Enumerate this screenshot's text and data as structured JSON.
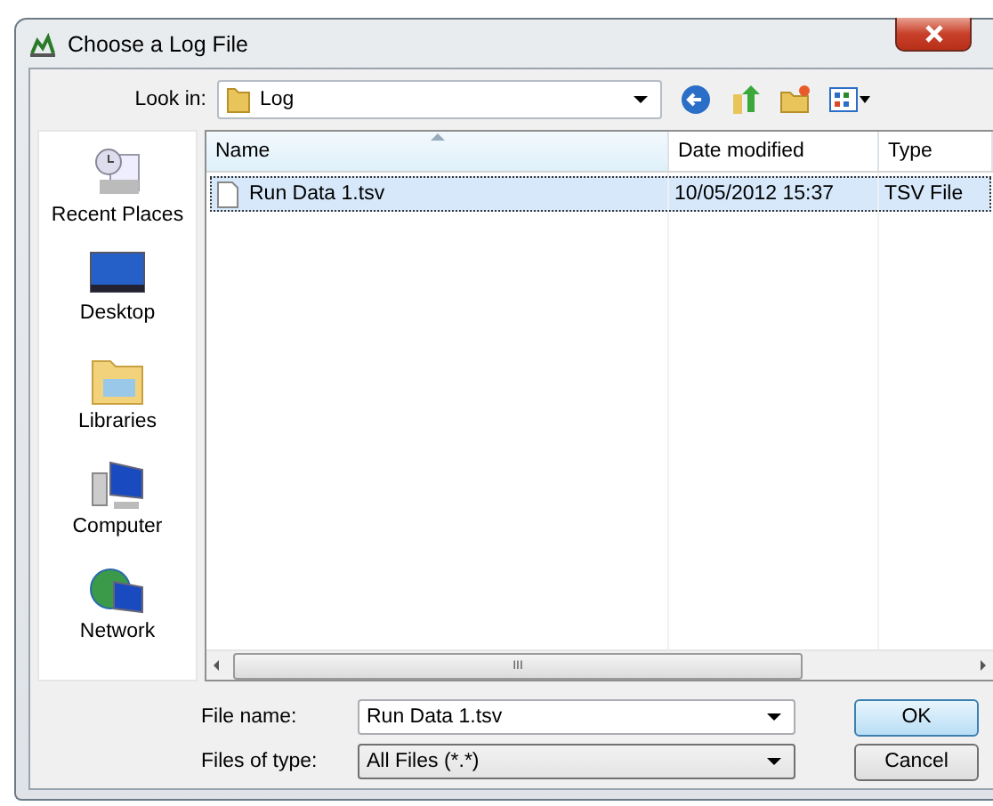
{
  "window": {
    "title": "Choose a Log File"
  },
  "look_in": {
    "label": "Look in:",
    "value": "Log"
  },
  "sidebar": {
    "items": [
      {
        "label": "Recent Places",
        "kind": "recent",
        "selected": false
      },
      {
        "label": "Desktop",
        "kind": "desktop",
        "selected": false
      },
      {
        "label": "Libraries",
        "kind": "libraries",
        "selected": false
      },
      {
        "label": "Computer",
        "kind": "computer",
        "selected": false
      },
      {
        "label": "Network",
        "kind": "network",
        "selected": false
      }
    ]
  },
  "table": {
    "columns": [
      "Name",
      "Date modified",
      "Type"
    ],
    "rows": [
      {
        "cells": [
          "Run Data 1.tsv",
          "10/05/2012 15:37",
          "TSV File"
        ],
        "selected": true
      }
    ]
  },
  "file_name": {
    "label": "File name:",
    "value": "Run Data 1.tsv"
  },
  "file_type": {
    "label": "Files of type:",
    "value": "All Files (*.*)"
  },
  "buttons": [
    "OK",
    "Cancel"
  ],
  "scroll_grip": "III"
}
